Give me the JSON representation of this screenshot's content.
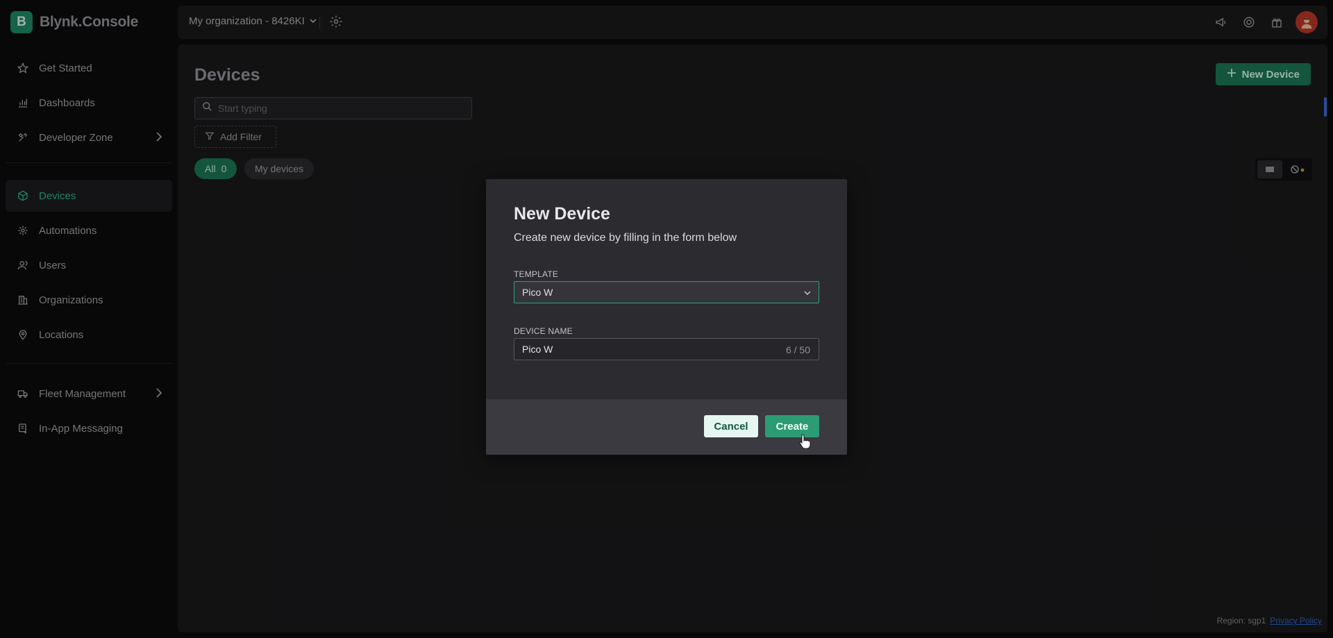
{
  "brand": {
    "logo_letter": "B",
    "name": "Blynk.Console",
    "accent": "#23c48e"
  },
  "sidebar": {
    "items": [
      {
        "label": "Get Started",
        "icon": "star-icon"
      },
      {
        "label": "Dashboards",
        "icon": "chart-icon"
      },
      {
        "label": "Developer Zone",
        "icon": "tools-icon",
        "has_submenu": true
      },
      {
        "label": "Devices",
        "icon": "cube-icon",
        "active": true
      },
      {
        "label": "Automations",
        "icon": "automation-icon"
      },
      {
        "label": "Users",
        "icon": "users-icon"
      },
      {
        "label": "Organizations",
        "icon": "building-icon"
      },
      {
        "label": "Locations",
        "icon": "location-pin-icon"
      },
      {
        "label": "Fleet Management",
        "icon": "truck-icon",
        "has_submenu": true
      },
      {
        "label": "In-App Messaging",
        "icon": "message-icon"
      }
    ]
  },
  "topbar": {
    "org_label": "My organization - 8426KI"
  },
  "main": {
    "title": "Devices",
    "new_device_label": "New Device",
    "search_placeholder": "Start typing",
    "add_filter_label": "Add Filter",
    "chips": {
      "all_label": "All",
      "all_count": "0",
      "my_label": "My devices"
    },
    "region_label": "Region: sgp1",
    "privacy_label": "Privacy Policy"
  },
  "modal": {
    "title": "New Device",
    "subtitle": "Create new device by filling in the form below",
    "template_label": "TEMPLATE",
    "template_value": "Pico W",
    "device_name_label": "DEVICE NAME",
    "device_name_value": "Pico W",
    "device_name_counter": "6 / 50",
    "cancel_label": "Cancel",
    "create_label": "Create"
  }
}
